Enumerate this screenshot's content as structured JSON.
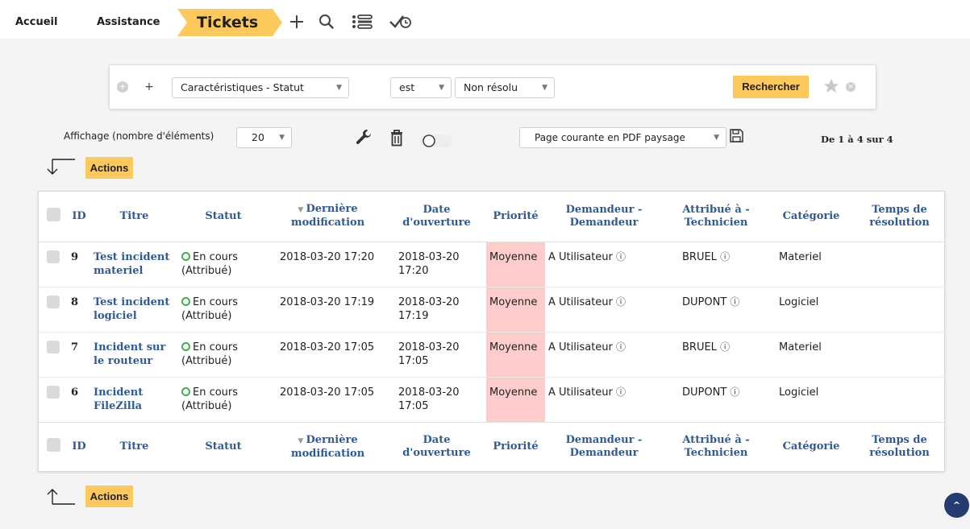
{
  "breadcrumb": {
    "items": [
      "Accueil",
      "Assistance",
      "Tickets"
    ]
  },
  "toolbar": {
    "icons": [
      "plus-icon",
      "search-icon",
      "list-icon",
      "check-clock-icon"
    ]
  },
  "search": {
    "criteria_field": "Caractéristiques - Statut",
    "operator": "est",
    "value": "Non résolu",
    "search_label": "Rechercher"
  },
  "display": {
    "per_page_label": "Affichage (nombre d'éléments)",
    "per_page_value": "20",
    "export_option": "Page courante en PDF paysage",
    "pagination": "De 1 à 4 sur 4"
  },
  "actions_label": "Actions",
  "table": {
    "columns": [
      "ID",
      "Titre",
      "Statut",
      "Dernière modification",
      "Date d'ouverture",
      "Priorité",
      "Demandeur - Demandeur",
      "Attribué à - Technicien",
      "Catégorie",
      "Temps de résolution"
    ],
    "rows": [
      {
        "id": "9",
        "title": "Test incident materiel",
        "status": "En cours (Attribué)",
        "modified": "2018-03-20 17:20",
        "opened": "2018-03-20 17:20",
        "priority": "Moyenne",
        "requester": "A Utilisateur",
        "technician": "BRUEL",
        "category": "Materiel",
        "resolution": ""
      },
      {
        "id": "8",
        "title": "Test incident logiciel",
        "status": "En cours (Attribué)",
        "modified": "2018-03-20 17:19",
        "opened": "2018-03-20 17:19",
        "priority": "Moyenne",
        "requester": "A Utilisateur",
        "technician": "DUPONT",
        "category": "Logiciel",
        "resolution": ""
      },
      {
        "id": "7",
        "title": "Incident sur le routeur",
        "status": "En cours (Attribué)",
        "modified": "2018-03-20 17:05",
        "opened": "2018-03-20 17:05",
        "priority": "Moyenne",
        "requester": "A Utilisateur",
        "technician": "BRUEL",
        "category": "Materiel",
        "resolution": ""
      },
      {
        "id": "6",
        "title": "Incident FileZilla",
        "status": "En cours (Attribué)",
        "modified": "2018-03-20 17:05",
        "opened": "2018-03-20 17:05",
        "priority": "Moyenne",
        "requester": "A Utilisateur",
        "technician": "DUPONT",
        "category": "Logiciel",
        "resolution": ""
      }
    ]
  },
  "colors": {
    "accent": "#fec95c",
    "link": "#2e5a99",
    "priority_medium": "#ffcccc",
    "status_ok": "#3cb44b",
    "scroll_button": "#263b70"
  }
}
